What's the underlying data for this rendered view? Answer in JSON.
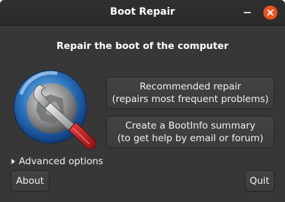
{
  "window": {
    "title": "Boot Repair",
    "controls": {
      "minimize": "minimize-icon",
      "close": "close-icon"
    }
  },
  "main": {
    "heading": "Repair the boot of the computer",
    "logo_icon": "boot-repair-wrench-logo-icon",
    "recommended_repair": {
      "line1": "Recommended repair",
      "line2": "(repairs most frequent problems)"
    },
    "bootinfo_summary": {
      "line1": "Create a BootInfo summary",
      "line2": "(to get help by email or forum)"
    },
    "advanced_options": {
      "label": "Advanced options",
      "expanded": false
    }
  },
  "footer": {
    "about_label": "About",
    "quit_label": "Quit"
  },
  "colors": {
    "window_bg": "#373737",
    "titlebar_bg": "#2c2c2c",
    "close_button": "#e95420",
    "text": "#f2f2f2"
  }
}
